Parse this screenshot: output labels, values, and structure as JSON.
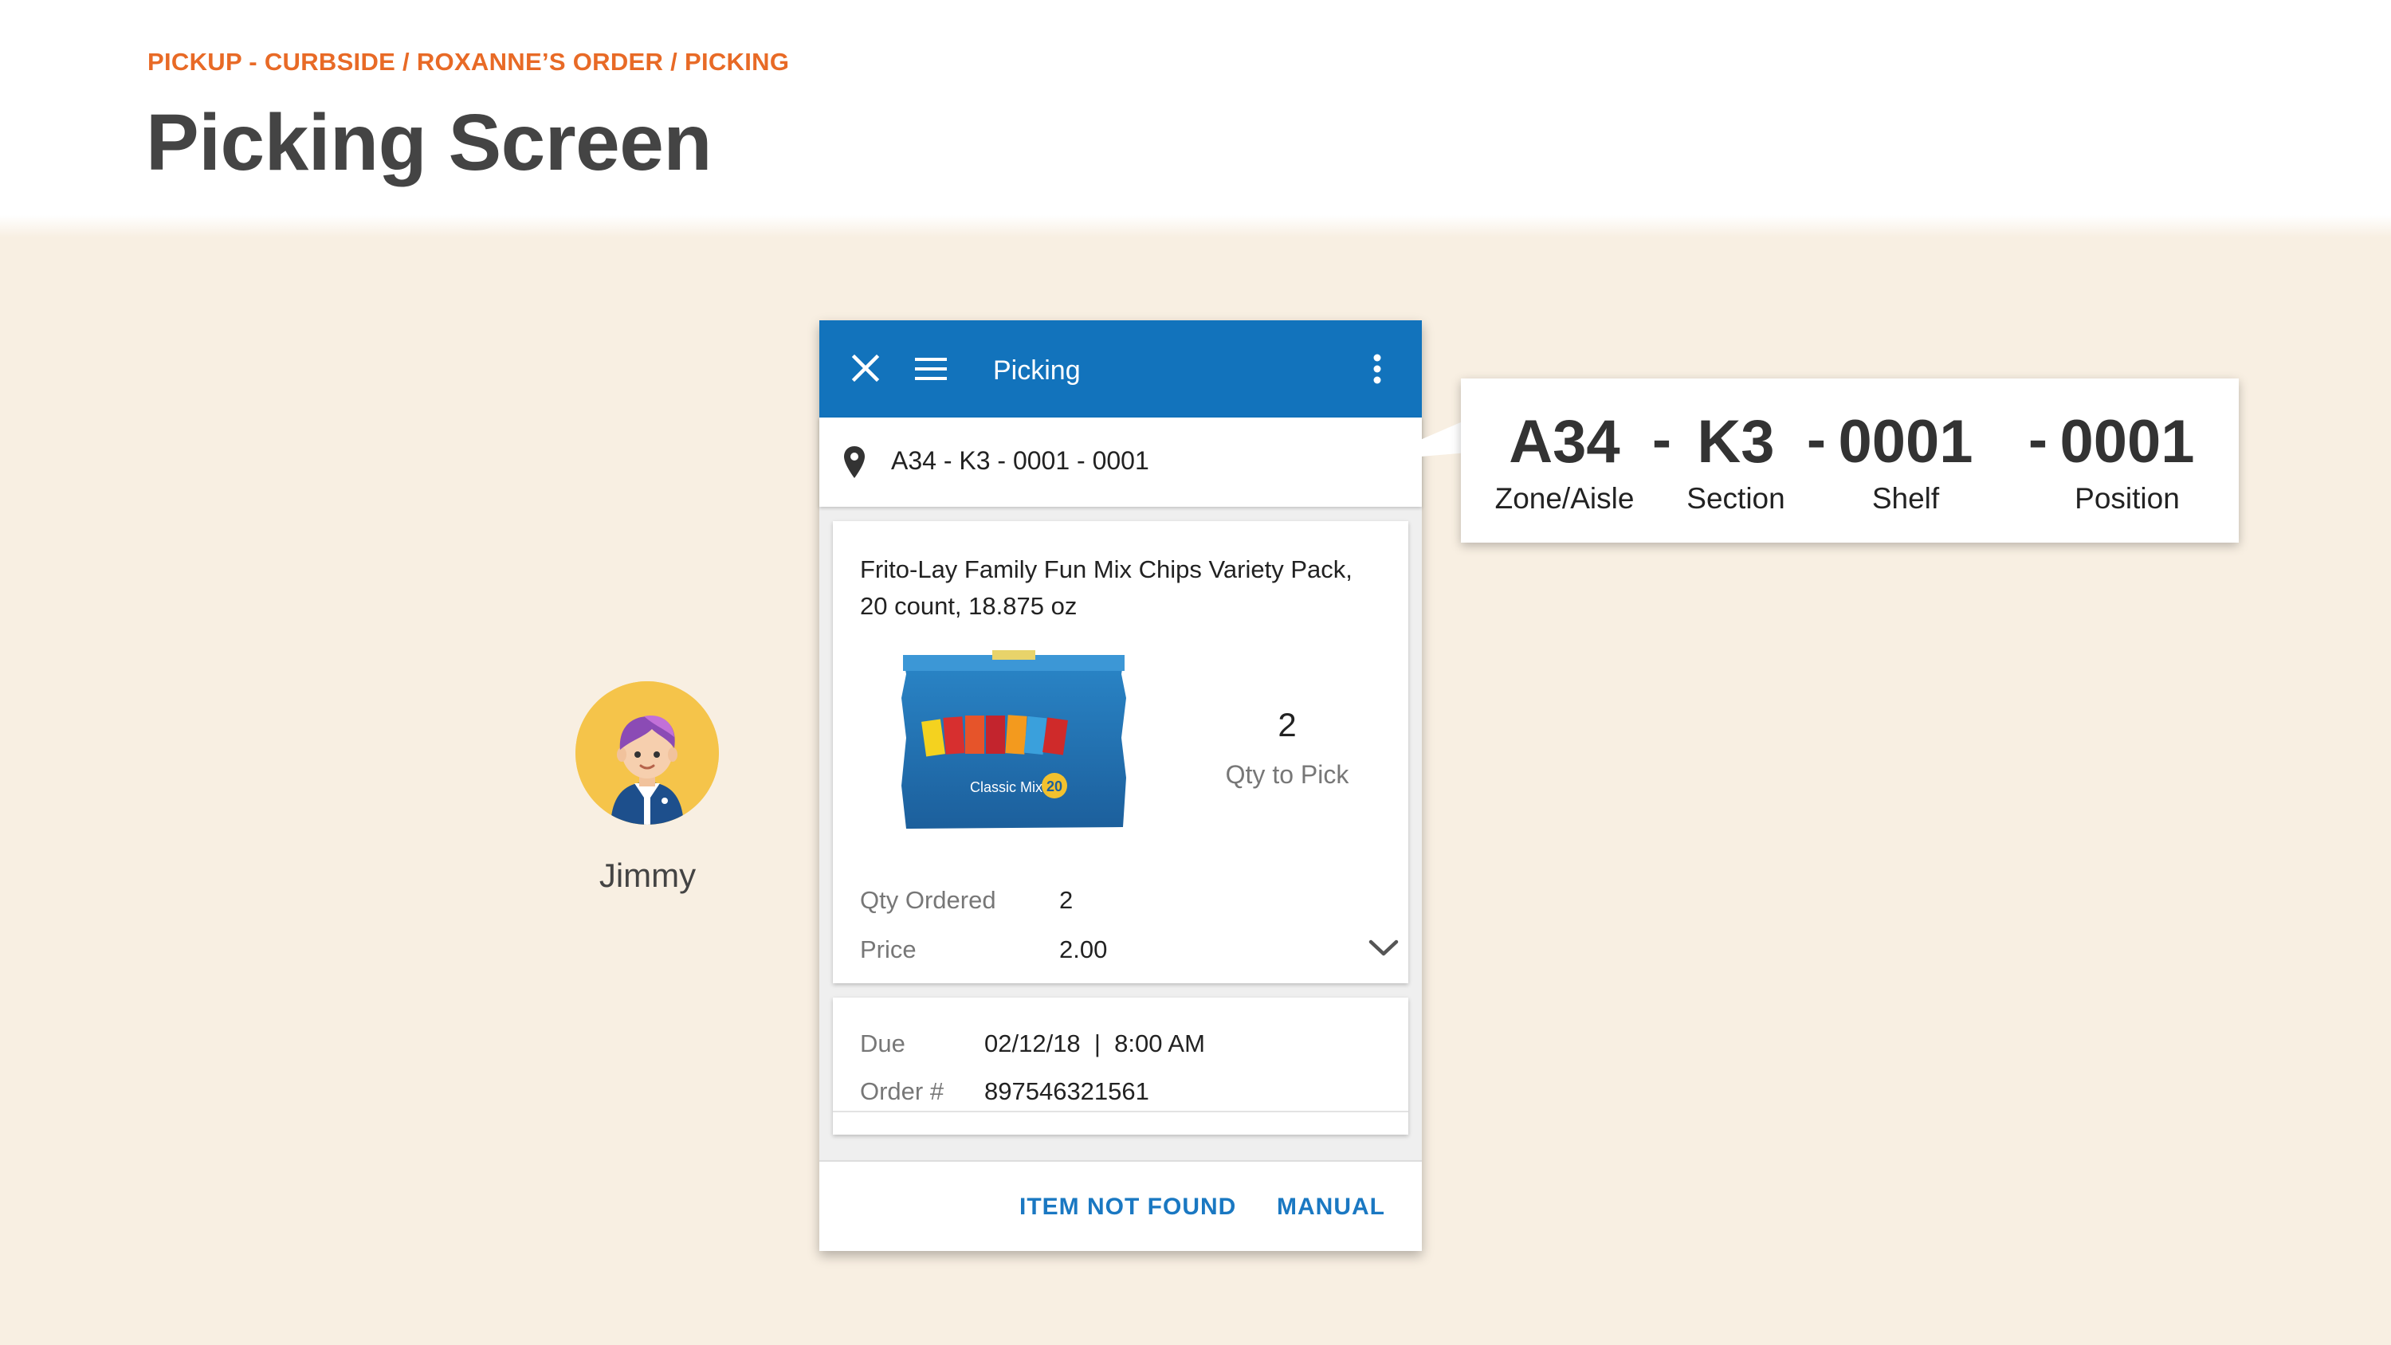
{
  "header": {
    "breadcrumb": "PICKUP - CURBSIDE / ROXANNE’S ORDER / PICKING",
    "title": "Picking Screen"
  },
  "avatar": {
    "name": "Jimmy"
  },
  "app": {
    "title": "Picking",
    "icons": {
      "close": "close-icon",
      "menu": "hamburger-menu-icon",
      "more": "more-vert-icon",
      "location": "location-pin-icon",
      "expand": "chevron-down-icon"
    },
    "location": "A34 - K3 - 0001 - 0001",
    "item": {
      "name": "Frito-Lay Family Fun Mix Chips Variety Pack, 20 count, 18.875 oz",
      "image_label": "Classic Mix",
      "image_count": "20",
      "qty_to_pick": "2",
      "qty_to_pick_label": "Qty to Pick",
      "qty_ordered_label": "Qty Ordered",
      "qty_ordered": "2",
      "price_label": "Price",
      "price": "2.00"
    },
    "order": {
      "due_label": "Due",
      "due": "02/12/18  |  8:00 AM",
      "order_label": "Order #",
      "order_number": "897546321561"
    },
    "actions": {
      "item_not_found": "ITEM NOT FOUND",
      "manual": "MANUAL"
    }
  },
  "callout": {
    "zone": "A34",
    "section": "K3",
    "shelf": "0001",
    "position": "0001",
    "separator": "-",
    "zone_label": "Zone/Aisle",
    "section_label": "Section",
    "shelf_label": "Shelf",
    "position_label": "Position"
  },
  "colors": {
    "accent_orange": "#e86a26",
    "app_bar_blue": "#1273bc",
    "button_blue": "#1a78c2",
    "stage_background": "#f8efe2",
    "avatar_background": "#f5c44a"
  }
}
